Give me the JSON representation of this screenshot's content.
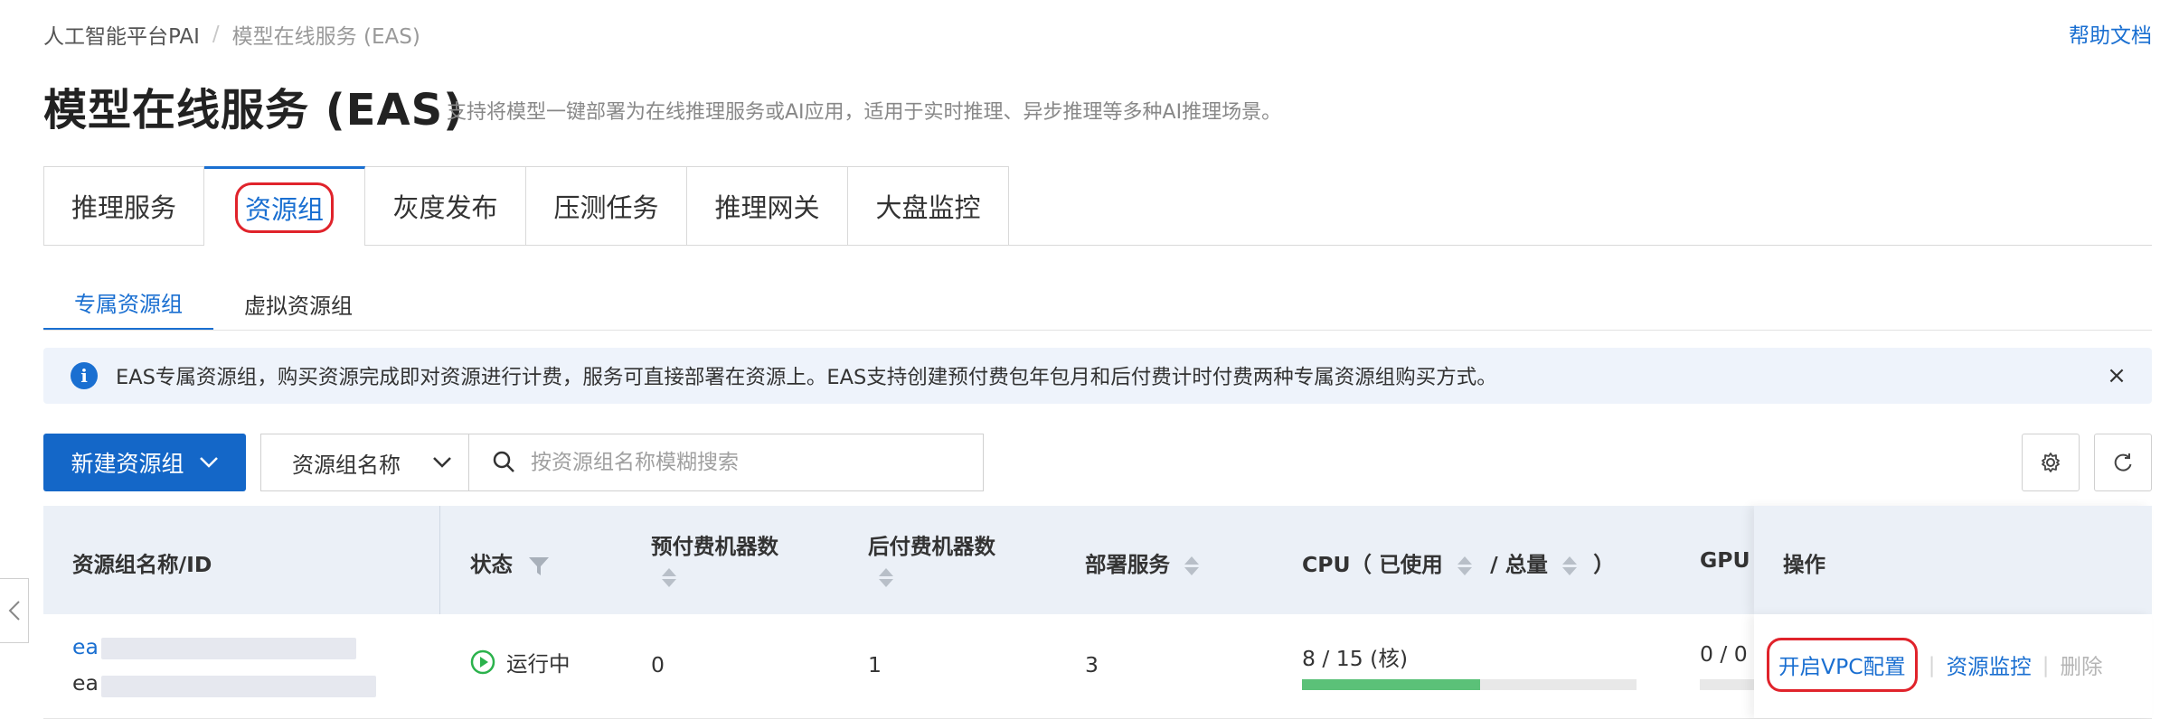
{
  "breadcrumb": {
    "root": "人工智能平台PAI",
    "separator": "/",
    "current": "模型在线服务 (EAS)"
  },
  "help_link": "帮助文档",
  "page": {
    "title": "模型在线服务 (EAS)",
    "description": "支持将模型一键部署为在线推理服务或AI应用，适用于实时推理、异步推理等多种AI推理场景。"
  },
  "main_tabs": [
    {
      "label": "推理服务",
      "active": false
    },
    {
      "label": "资源组",
      "active": true
    },
    {
      "label": "灰度发布",
      "active": false
    },
    {
      "label": "压测任务",
      "active": false
    },
    {
      "label": "推理网关",
      "active": false
    },
    {
      "label": "大盘监控",
      "active": false
    }
  ],
  "sub_tabs": [
    {
      "label": "专属资源组",
      "active": true
    },
    {
      "label": "虚拟资源组",
      "active": false
    }
  ],
  "notice": {
    "text": "EAS专属资源组，购买资源完成即对资源进行计费，服务可直接部署在资源上。EAS支持创建预付费包年包月和后付费计时付费两种专属资源组购买方式。",
    "close": "×"
  },
  "toolbar": {
    "new_button": "新建资源组",
    "filter_select": "资源组名称",
    "search_placeholder": "按资源组名称模糊搜索"
  },
  "table": {
    "headers": {
      "name": "资源组名称/ID",
      "status": "状态",
      "prepaid": "预付费机器数",
      "postpaid": "后付费机器数",
      "services": "部署服务",
      "cpu_prefix": "CPU（ 已使用",
      "cpu_mid": "/ 总量",
      "cpu_suffix": "）",
      "gpu": "GPU",
      "actions": "操作"
    },
    "rows": [
      {
        "name_prefix": "ea",
        "id_prefix": "ea",
        "status": "运行中",
        "prepaid": "0",
        "postpaid": "1",
        "services": "3",
        "cpu": "8 / 15 (核)",
        "cpu_used_fraction": 0.533,
        "gpu": "0 / 0",
        "actions": {
          "vpc": "开启VPC配置",
          "monitor": "资源监控",
          "delete": "删除"
        }
      }
    ]
  },
  "colors": {
    "accent": "#1a6fd1",
    "highlight": "#e0232b",
    "running": "#2bb24c",
    "progress": "#5bc178"
  }
}
